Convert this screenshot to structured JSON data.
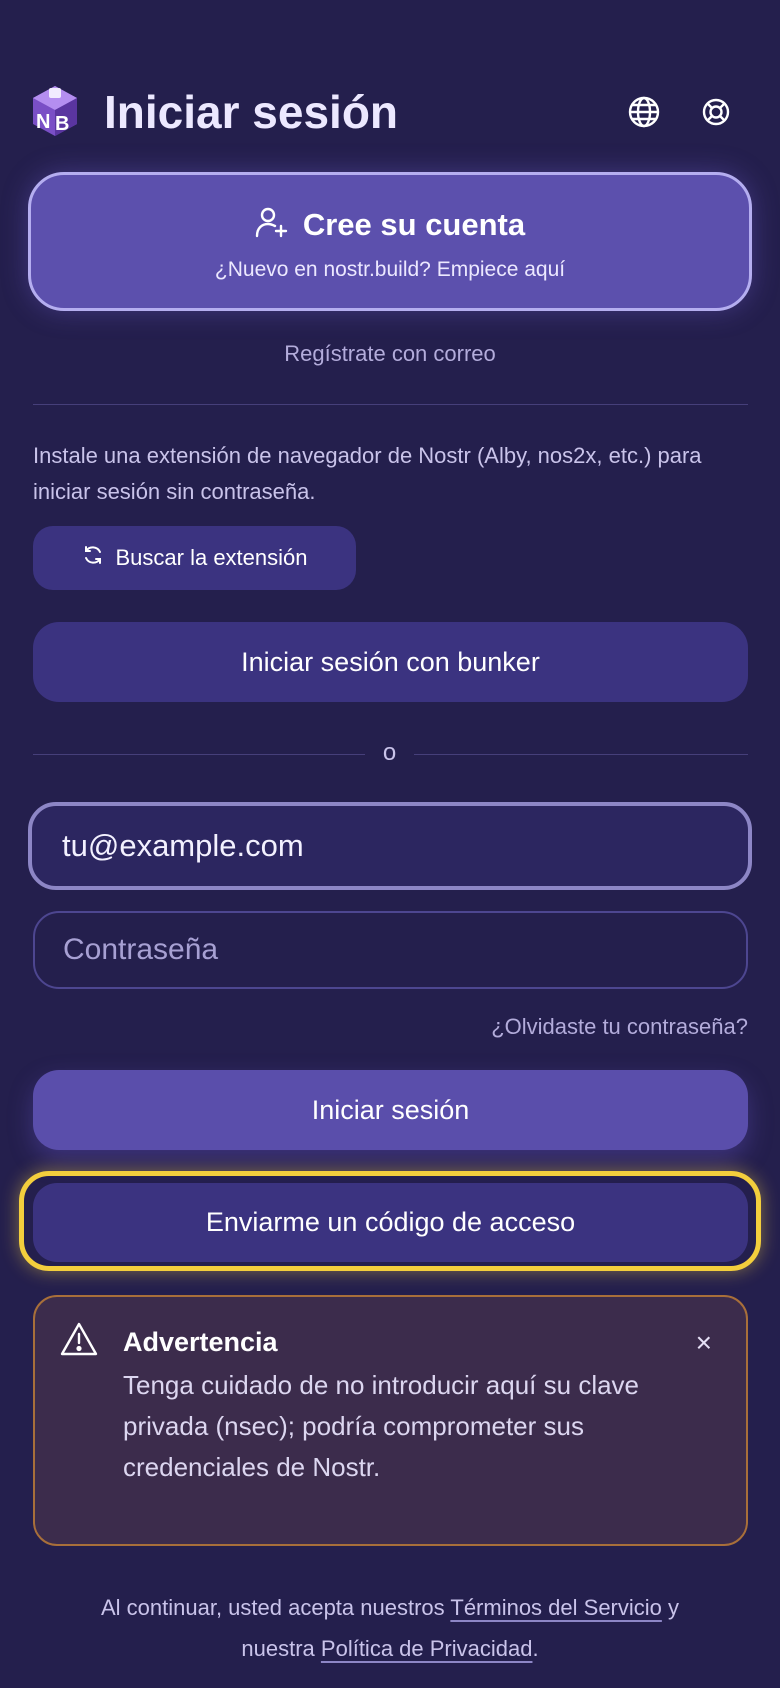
{
  "header": {
    "title": "Iniciar sesión",
    "logo_text": "NB",
    "globe_icon": "globe-icon",
    "help_icon": "lifebuoy-icon"
  },
  "create_account": {
    "title": "Cree su cuenta",
    "subtitle": "¿Nuevo en nostr.build? Empiece aquí",
    "icon": "user-plus-icon"
  },
  "register_email": "Regístrate con correo",
  "extension": {
    "description": "Instale una extensión de navegador de Nostr (Alby, nos2x, etc.) para iniciar sesión sin contraseña.",
    "search_button": "Buscar la extensión",
    "search_icon": "refresh-icon"
  },
  "bunker_button": "Iniciar sesión con bunker",
  "or_label": "o",
  "form": {
    "email_value": "tu@example.com",
    "password_placeholder": "Contraseña",
    "forgot_link": "¿Olvidaste tu contraseña?",
    "login_button": "Iniciar sesión",
    "code_button": "Enviarme un código de acceso"
  },
  "warning": {
    "title": "Advertencia",
    "body": "Tenga cuidado de no introducir aquí su clave privada (nsec); podría comprometer sus credenciales de Nostr.",
    "icon": "warning-triangle-icon",
    "close": "×"
  },
  "footer": {
    "prefix": "Al continuar, usted acepta nuestros ",
    "terms_link": "Términos del Servicio",
    "middle": " y nuestra ",
    "privacy_link": "Política de Privacidad",
    "suffix": "."
  },
  "colors": {
    "background": "#241f4d",
    "primary": "#5c50ad",
    "secondary_button": "#3b3380",
    "highlight": "#f3ce3d",
    "warning_border": "#a86f3a"
  }
}
